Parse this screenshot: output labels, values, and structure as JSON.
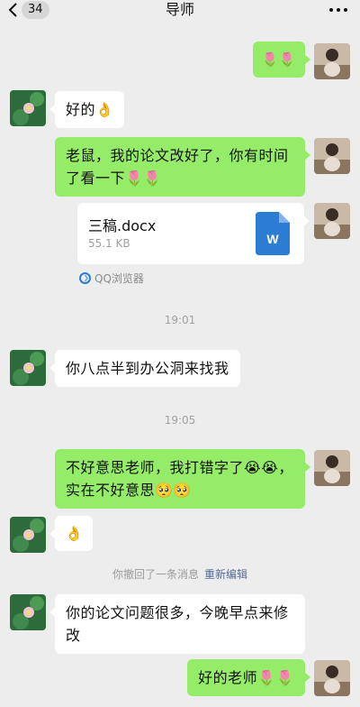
{
  "header": {
    "back_count": "34",
    "title": "导师"
  },
  "messages": {
    "m1": "🌷🌷",
    "m2": "好的👌",
    "m3_line1": "老鼠，我的论文改好了，你有时间",
    "m3_line2": "了看一下🌷🌷",
    "file_name": "三稿.docx",
    "file_size": "55.1 KB",
    "file_icon_letter": "W",
    "file_source": "QQ浏览器",
    "time1": "19:01",
    "m4": "你八点半到办公洞来找我",
    "time2": "19:05",
    "m5_line1": "不好意思老师，我打错字了😭😭，",
    "m5_line2": "实在不好意思🥺🥺",
    "m6": "👌",
    "recall_text": "你撤回了一条消息",
    "recall_edit": "重新编辑",
    "m7_line1": "你的论文问题很多，今晚早点来修",
    "m7_line2": "改",
    "m8": "好的老师🌷🌷"
  },
  "colors": {
    "bg": "#ededed",
    "mine_bubble": "#95ec69",
    "their_bubble": "#ffffff",
    "link": "#576b95",
    "word_blue": "#2b7cd3"
  }
}
